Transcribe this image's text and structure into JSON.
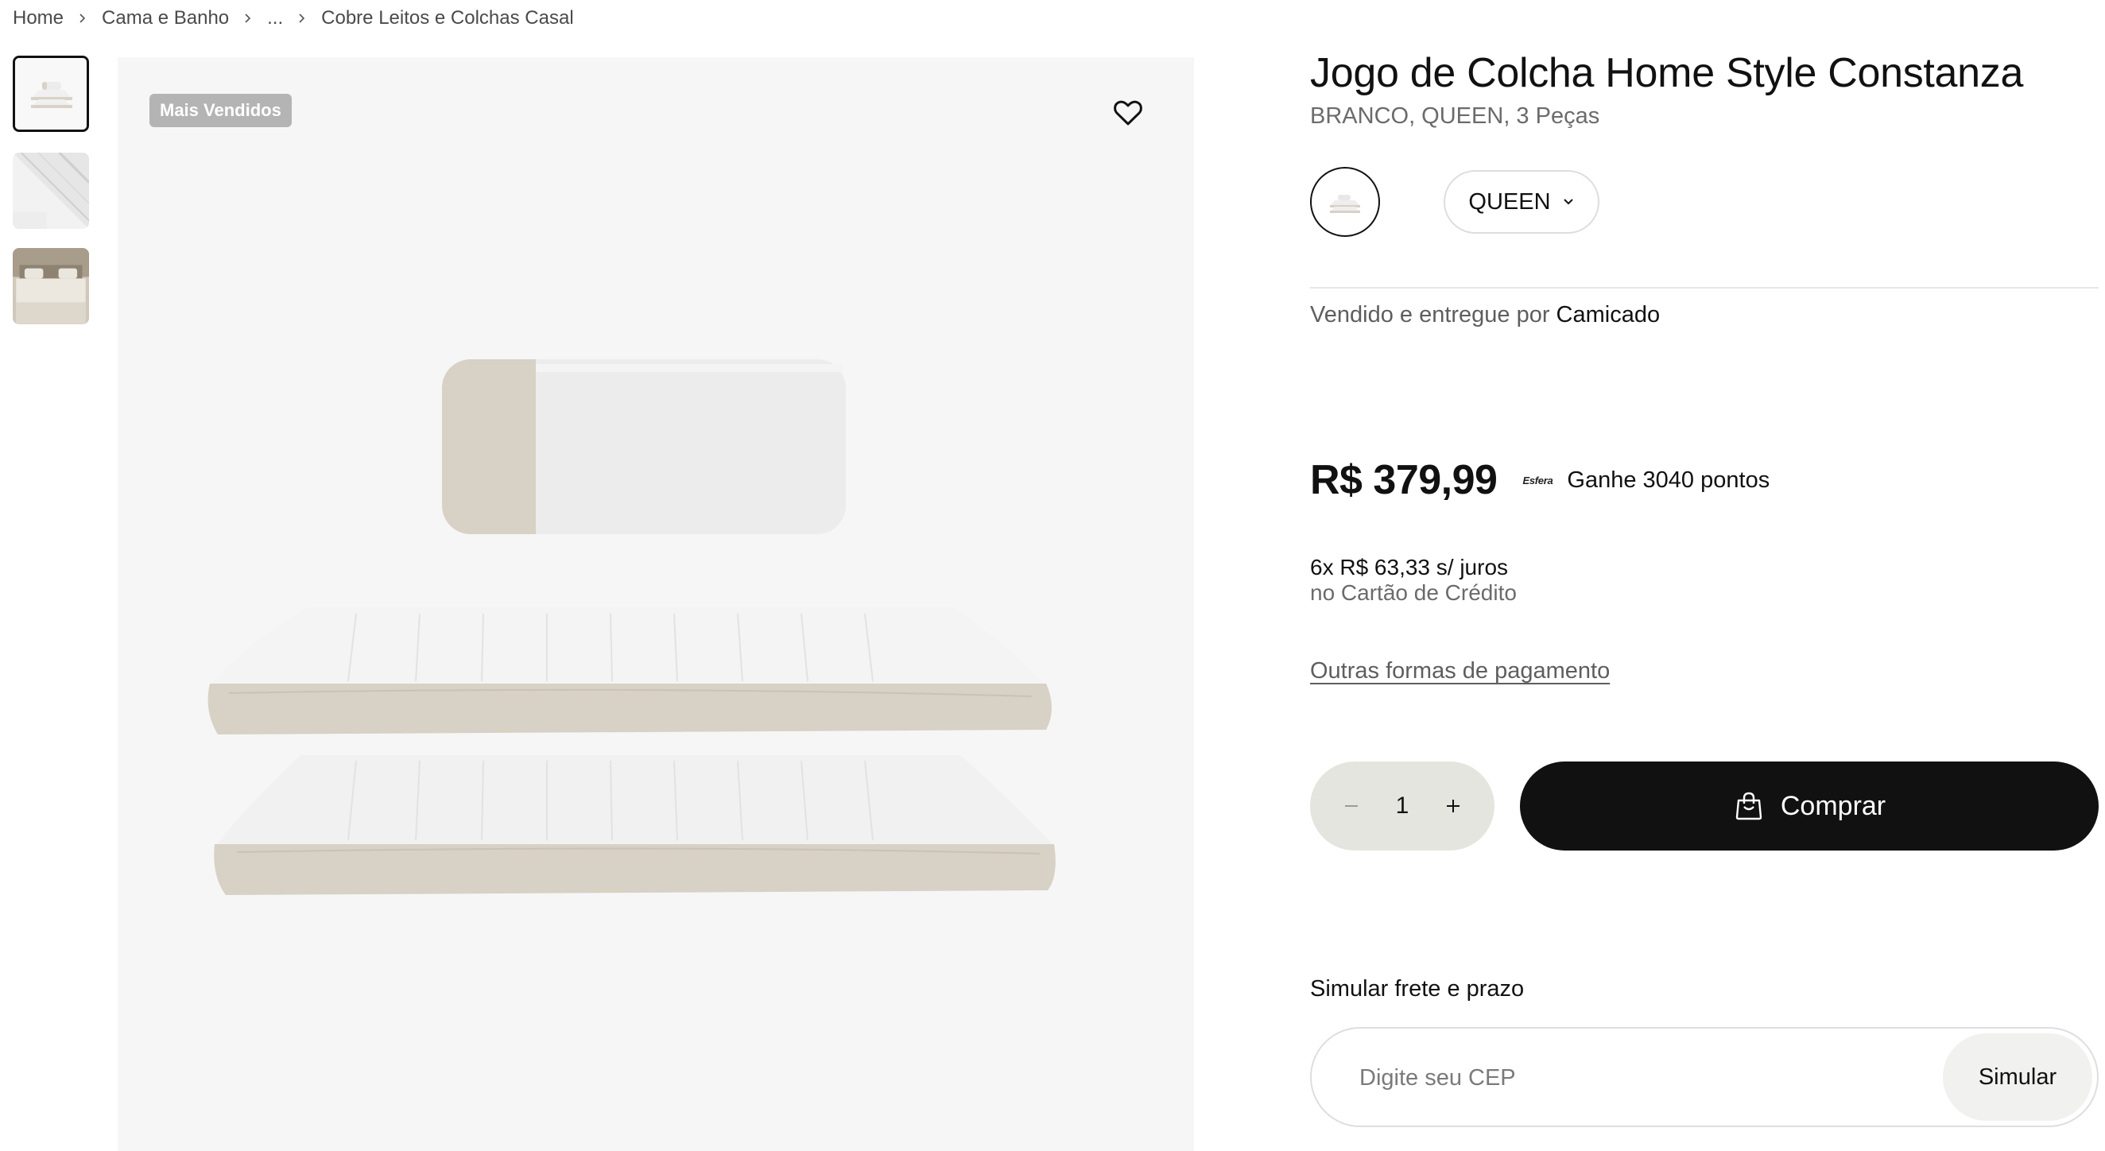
{
  "breadcrumb": {
    "items": [
      "Home",
      "Cama e Banho",
      "...",
      "Cobre Leitos e Colchas Casal"
    ]
  },
  "gallery": {
    "badge": "Mais Vendidos",
    "thumbnail_icons": [
      "bedspread-set-thumbnail",
      "quilt-fold-thumbnail",
      "bedroom-thumbnail"
    ],
    "favorite_icon": "heart-icon"
  },
  "product": {
    "title": "Jogo de Colcha Home Style Constanza",
    "subtitle": "BRANCO, QUEEN, 3 Peças",
    "size_selected": "QUEEN",
    "seller_label": "Vendido e entregue por",
    "seller_name": "Camicado"
  },
  "pricing": {
    "price": "R$ 379,99",
    "esfera_logo": "Esfera",
    "points": "Ganhe 3040 pontos",
    "installments": "6x R$ 63,33 s/ juros",
    "installments_note": "no Cartão de Crédito",
    "other_payments": "Outras formas de pagamento"
  },
  "cart": {
    "quantity": "1",
    "buy_label": "Comprar"
  },
  "shipping": {
    "label": "Simular frete e prazo",
    "placeholder": "Digite seu CEP",
    "button": "Simular"
  },
  "colors": {
    "buy_button": "#111111",
    "quantity_bg": "#e5e5e0",
    "badge_bg": "#b4b4b4",
    "image_bg": "#f6f6f6",
    "linen_border": "#d7d1c6"
  }
}
